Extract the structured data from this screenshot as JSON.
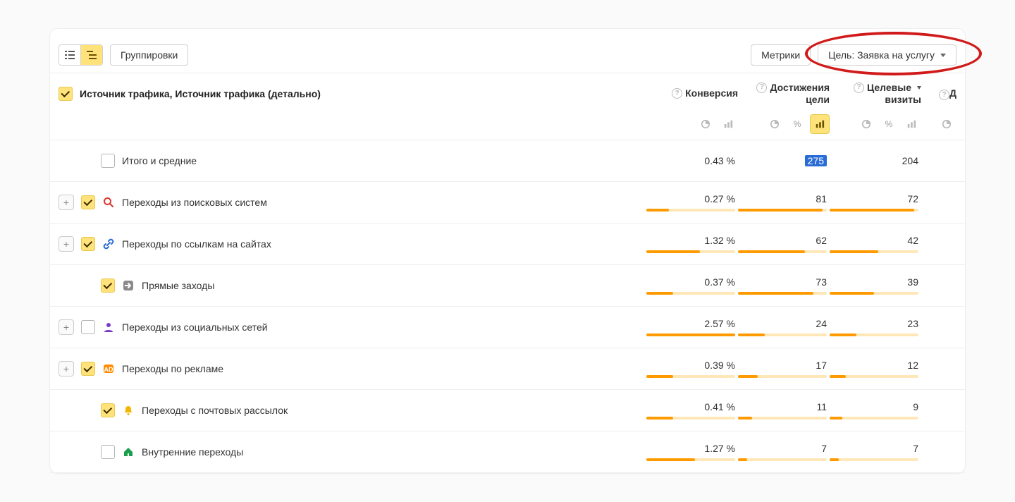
{
  "toolbar": {
    "groupings_label": "Группировки",
    "metrics_label": "Метрики",
    "goal_label": "Цель: Заявка на услугу"
  },
  "columns": {
    "dimension": "Источник трафика, Источник трафика (детально)",
    "c1": "Конверсия",
    "c2_line1": "Достижения",
    "c2_line2": "цели",
    "c3_line1": "Целевые",
    "c3_line2": "визиты",
    "overflow_hint": "Д"
  },
  "rows": [
    {
      "id": "total",
      "label": "Итого и средние",
      "expand": null,
      "checked": false,
      "indent": 1,
      "icon": null,
      "conv": "0.43 %",
      "goals": "275",
      "visits": "204",
      "highlight_goals": true
    },
    {
      "id": "search",
      "label": "Переходы из поисковых систем",
      "expand": true,
      "checked": true,
      "indent": 0,
      "icon": "search",
      "conv": "0.27 %",
      "goals": "81",
      "visits": "72",
      "bar": true,
      "fill": [
        0.25,
        0.95,
        0.95
      ]
    },
    {
      "id": "links",
      "label": "Переходы по ссылкам на сайтах",
      "expand": true,
      "checked": true,
      "indent": 0,
      "icon": "link",
      "conv": "1.32 %",
      "goals": "62",
      "visits": "42",
      "bar": true,
      "fill": [
        0.6,
        0.75,
        0.55
      ]
    },
    {
      "id": "direct",
      "label": "Прямые заходы",
      "expand": null,
      "checked": true,
      "indent": 1,
      "icon": "arrow-in",
      "conv": "0.37 %",
      "goals": "73",
      "visits": "39",
      "bar": true,
      "fill": [
        0.3,
        0.85,
        0.5
      ]
    },
    {
      "id": "social",
      "label": "Переходы из социальных сетей",
      "expand": true,
      "checked": false,
      "indent": 0,
      "icon": "social",
      "conv": "2.57 %",
      "goals": "24",
      "visits": "23",
      "bar": true,
      "fill": [
        1.0,
        0.3,
        0.3
      ]
    },
    {
      "id": "ad",
      "label": "Переходы по рекламе",
      "expand": true,
      "checked": true,
      "indent": 0,
      "icon": "ad",
      "conv": "0.39 %",
      "goals": "17",
      "visits": "12",
      "bar": true,
      "fill": [
        0.3,
        0.22,
        0.18
      ]
    },
    {
      "id": "mail",
      "label": "Переходы с почтовых рассылок",
      "expand": null,
      "checked": true,
      "indent": 1,
      "icon": "bell",
      "conv": "0.41 %",
      "goals": "11",
      "visits": "9",
      "bar": true,
      "fill": [
        0.3,
        0.16,
        0.14
      ]
    },
    {
      "id": "internal",
      "label": "Внутренние переходы",
      "expand": null,
      "checked": false,
      "indent": 1,
      "icon": "house",
      "conv": "1.27 %",
      "goals": "7",
      "visits": "7",
      "bar": true,
      "fill": [
        0.55,
        0.1,
        0.1
      ]
    }
  ]
}
